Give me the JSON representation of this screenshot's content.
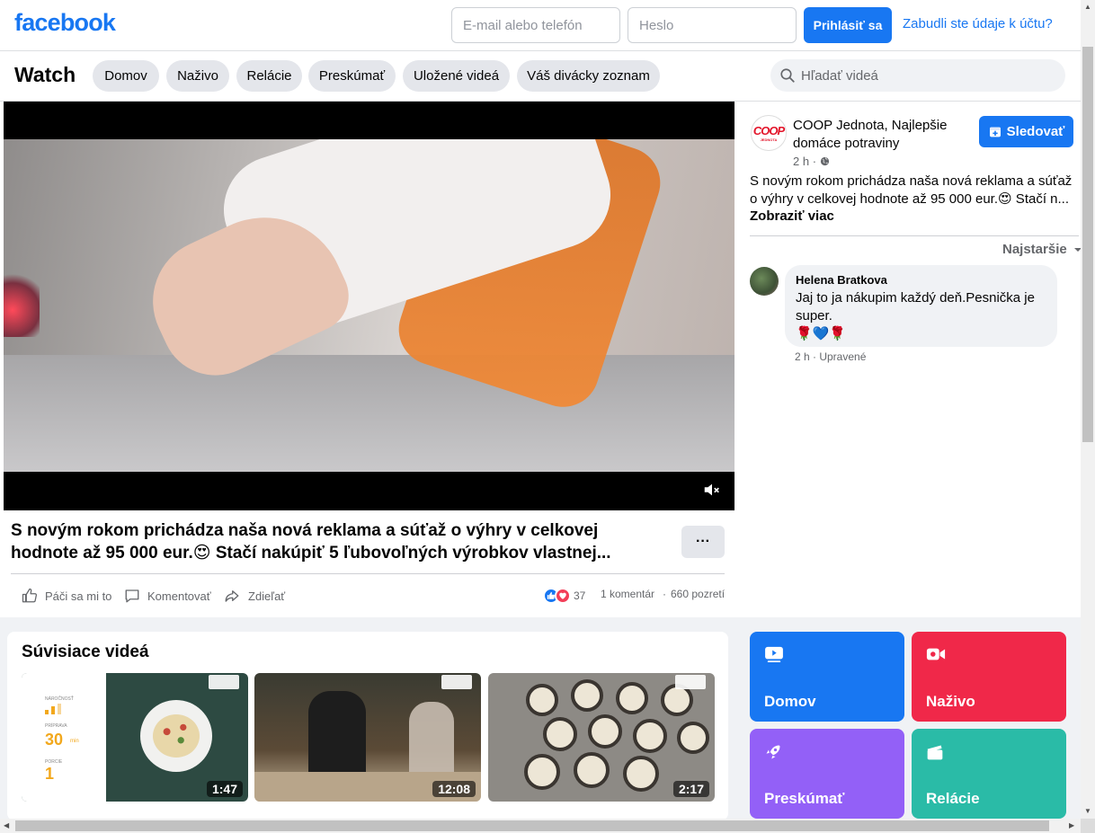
{
  "header": {
    "logo": "facebook",
    "email_placeholder": "E-mail alebo telefón",
    "password_placeholder": "Heslo",
    "login_label": "Prihlásiť sa",
    "forgot_label": "Zabudli ste údaje k účtu?"
  },
  "watch": {
    "title": "Watch",
    "tabs": [
      "Domov",
      "Naživo",
      "Relácie",
      "Preskúmať",
      "Uložené videá",
      "Váš divácky zoznam"
    ],
    "search_placeholder": "Hľadať videá"
  },
  "video": {
    "title": "S novým rokom prichádza naša nová reklama a súťaž o výhry v celkovej hodnote až 95 000 eur.😍 Stačí nakúpiť 5 ľubovoľných výrobkov vlastnej...",
    "more_label": "···",
    "like_label": "Páči sa mi to",
    "comment_label": "Komentovať",
    "share_label": "Zdieľať",
    "reaction_count": "37",
    "comments_count": "1 komentár",
    "views": "660 pozretí",
    "stat_sep": "·"
  },
  "post": {
    "page_name": "COOP Jednota, Najlepšie domáce potraviny",
    "avatar_text": "COOP",
    "avatar_sub": "JEDNOTA",
    "time": "2 h",
    "time_sep": "·",
    "follow_label": "Sledovať",
    "text": "S novým rokom prichádza naša nová reklama a súťaž o výhry v celkovej hodnote až 95 000 eur.😍 Stačí n...",
    "see_more": "Zobraziť viac",
    "sort_label": "Najstaršie"
  },
  "comment": {
    "author": "Helena Bratkova",
    "text": "Jaj to ja nákupim každý deň.Pesnička je super.",
    "emojis": "🌹💙🌹",
    "meta": "2 h · Upravené"
  },
  "related": {
    "title": "Súvisiace videá",
    "videos": [
      {
        "duration": "1:47",
        "label1": "NÁROČNOSŤ",
        "label2": "PRÍPRAVA",
        "time": "30",
        "unit": "min",
        "label3": "PORCIE",
        "portions": "1"
      },
      {
        "duration": "12:08"
      },
      {
        "duration": "2:17"
      }
    ]
  },
  "tiles": [
    {
      "label": "Domov",
      "color": "#1877f2"
    },
    {
      "label": "Naživo",
      "color": "#f02849"
    },
    {
      "label": "Preskúmať",
      "color": "#9360f7"
    },
    {
      "label": "Relácie",
      "color": "#2abba7"
    }
  ]
}
